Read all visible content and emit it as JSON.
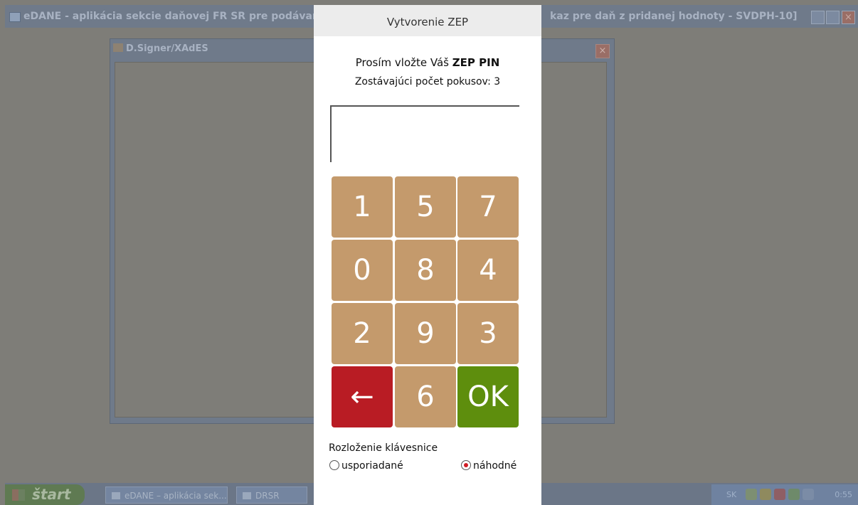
{
  "background_window": {
    "title_left": "eDANE - aplikácia sekcie daňovej FR SR pre podávanie d",
    "title_right": "kaz pre daň z pridanej hodnoty - SVDPH-10]"
  },
  "signer_window": {
    "title": "D.Signer/XAdES",
    "close_label": "×"
  },
  "taskbar": {
    "start_label": "štart",
    "tasks": [
      "eDANE – aplikácia sek...",
      "DRSR"
    ],
    "language": "SK",
    "time": "0:55"
  },
  "dialog": {
    "header": "Vytvorenie ZEP",
    "prompt_prefix": "Prosím vložte Váš",
    "prompt_bold": "ZEP PIN",
    "attempts_label": "Zostávajúci počet pokusov:",
    "attempts_value": "3",
    "pin_value": "",
    "keys": [
      "1",
      "5",
      "7",
      "0",
      "8",
      "4",
      "2",
      "9",
      "3",
      "←",
      "6",
      "OK"
    ],
    "layout_label": "Rozloženie klávesnice",
    "layout_options": [
      {
        "label": "usporiadané",
        "selected": false
      },
      {
        "label": "náhodné",
        "selected": true
      }
    ]
  },
  "colors": {
    "key": "#c49a6c",
    "backspace": "#b91c24",
    "ok": "#5e8e0d",
    "radio_selected": "#d11b24"
  },
  "icons": {
    "backspace": "left-arrow-icon"
  }
}
